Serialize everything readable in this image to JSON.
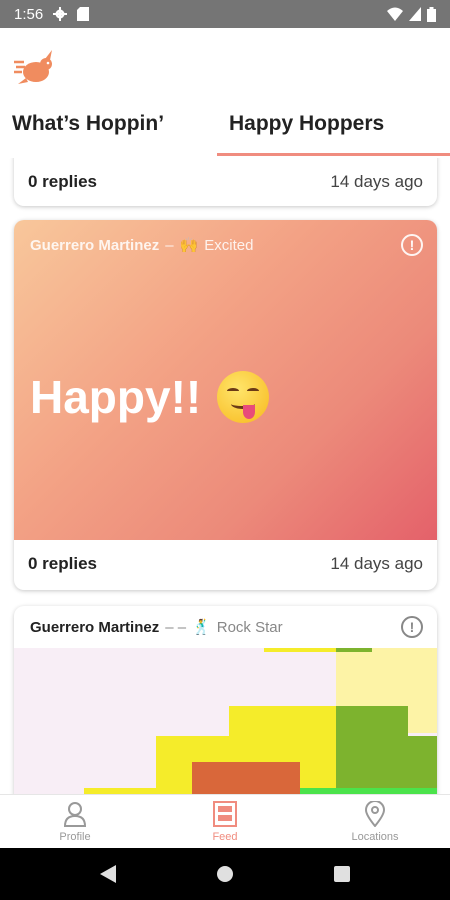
{
  "status_bar": {
    "time": "1:56"
  },
  "tabs": [
    {
      "label": "What’s Hoppin’"
    },
    {
      "label": "Happy Hoppers"
    }
  ],
  "feed": {
    "top_card": {
      "replies": "0 replies",
      "age": "14 days ago"
    },
    "happy_card": {
      "author": "Guerrero Martinez",
      "separator": "–",
      "mood": "Excited",
      "message": "Happy!!",
      "replies": "0 replies",
      "age": "14 days ago",
      "gradient_colors": [
        "#f8c79b",
        "#e4616a"
      ]
    },
    "rock_card": {
      "author": "Guerrero Martinez",
      "separator": "– –",
      "mood": "Rock Star"
    }
  },
  "bottom_nav": [
    {
      "label": "Profile",
      "icon": "person-icon"
    },
    {
      "label": "Feed",
      "icon": "feed-icon",
      "active": true
    },
    {
      "label": "Locations",
      "icon": "location-pin-icon"
    }
  ],
  "colors": {
    "accent": "#f08c7f",
    "status_bar": "#757575"
  }
}
